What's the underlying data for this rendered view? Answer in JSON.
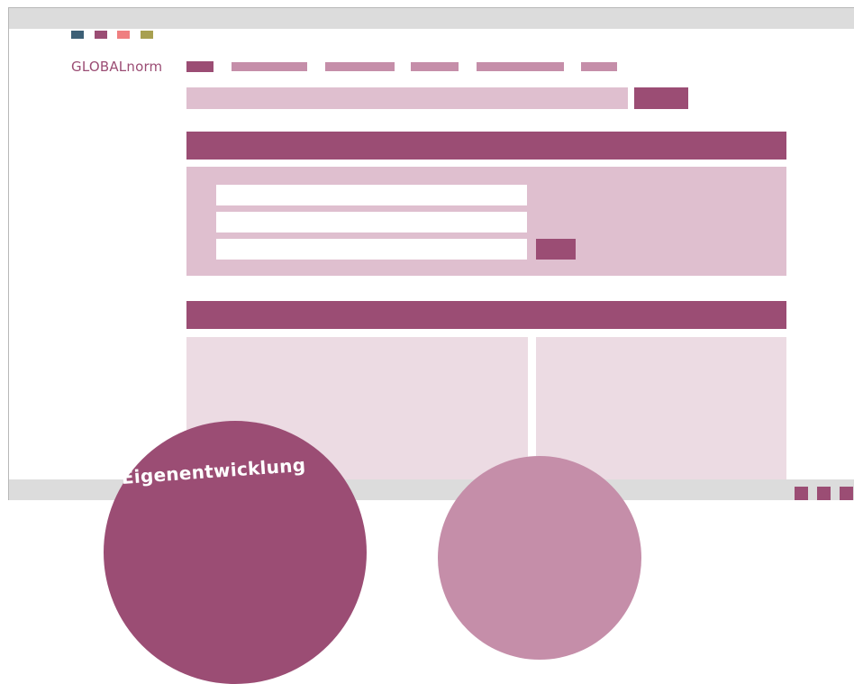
{
  "logo": {
    "brand": "GLOBAL",
    "suffix": "norm"
  },
  "bubble": {
    "label": "Eigenentwicklung"
  },
  "colors": {
    "brand": "#9b4d74",
    "light": "#dfbfcf",
    "lighter": "#ecdbe3",
    "mid": "#c58ea9",
    "swatches": [
      "#3d6076",
      "#9b4d74",
      "#ef7f80",
      "#a8a050"
    ]
  }
}
